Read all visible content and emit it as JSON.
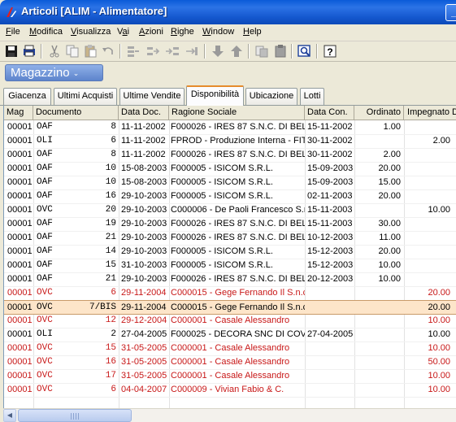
{
  "window": {
    "title": "Articoli [ALIM - Alimentatore]",
    "minimize_label": "_"
  },
  "menu": [
    {
      "label": "File",
      "key": "F"
    },
    {
      "label": "Modifica",
      "key": "M"
    },
    {
      "label": "Visualizza",
      "key": "V"
    },
    {
      "label": "Vai",
      "key": "a"
    },
    {
      "label": "Azioni",
      "key": "A"
    },
    {
      "label": "Righe",
      "key": "R"
    },
    {
      "label": "Window",
      "key": "W"
    },
    {
      "label": "Help",
      "key": "H"
    }
  ],
  "toolbar": {
    "icons": [
      "save-icon",
      "print-preview-icon",
      "cut-icon",
      "copy-icon",
      "paste-icon",
      "undo-icon",
      "insert-row-icon",
      "move-row-right-icon",
      "move-row-in-icon",
      "move-row-end-icon",
      "arrow-down-icon",
      "arrow-up-icon",
      "copy-record-icon",
      "paste-record-icon",
      "preview-icon",
      "help-icon"
    ]
  },
  "panel": {
    "title": "Magazzino",
    "arrow": "⌄"
  },
  "tabs": [
    {
      "label": "Giacenza"
    },
    {
      "label": "Ultimi Acquisti"
    },
    {
      "label": "Ultime Vendite"
    },
    {
      "label": "Disponibilità",
      "active": true
    },
    {
      "label": "Ubicazione"
    },
    {
      "label": "Lotti"
    }
  ],
  "grid": {
    "columns": [
      "Mag",
      "Documento",
      "Data Doc.",
      "Ragione Sociale",
      "Data Con.",
      "Ordinato",
      "Impegnato D"
    ],
    "rows": [
      {
        "mag": "00001",
        "doc_type": "OAF",
        "doc_num": "8",
        "data_doc": "11-11-2002",
        "ragione": "F000026 - IRES 87 S.N.C. DI BELL",
        "data_con": "15-11-2002",
        "ordinato": "1.00",
        "impegnato": "",
        "style": "normal"
      },
      {
        "mag": "00001",
        "doc_type": "OLI",
        "doc_num": "6",
        "data_doc": "11-11-2002",
        "ragione": "FPROD   - Produzione Interna - FIT",
        "data_con": "30-11-2002",
        "ordinato": "",
        "impegnato": "2.00",
        "style": "normal"
      },
      {
        "mag": "00001",
        "doc_type": "OAF",
        "doc_num": "8",
        "data_doc": "11-11-2002",
        "ragione": "F000026 - IRES 87 S.N.C. DI BELL",
        "data_con": "30-11-2002",
        "ordinato": "2.00",
        "impegnato": "",
        "style": "normal"
      },
      {
        "mag": "00001",
        "doc_type": "OAF",
        "doc_num": "10",
        "data_doc": "15-08-2003",
        "ragione": "F000005 - ISICOM S.R.L.",
        "data_con": "15-09-2003",
        "ordinato": "20.00",
        "impegnato": "",
        "style": "normal"
      },
      {
        "mag": "00001",
        "doc_type": "OAF",
        "doc_num": "10",
        "data_doc": "15-08-2003",
        "ragione": "F000005 - ISICOM S.R.L.",
        "data_con": "15-09-2003",
        "ordinato": "15.00",
        "impegnato": "",
        "style": "normal"
      },
      {
        "mag": "00001",
        "doc_type": "OAF",
        "doc_num": "16",
        "data_doc": "29-10-2003",
        "ragione": "F000005 - ISICOM S.R.L.",
        "data_con": "02-11-2003",
        "ordinato": "20.00",
        "impegnato": "",
        "style": "normal"
      },
      {
        "mag": "00001",
        "doc_type": "OVC",
        "doc_num": "20",
        "data_doc": "29-10-2003",
        "ragione": "C000006 - De Paoli Francesco S.r",
        "data_con": "15-11-2003",
        "ordinato": "",
        "impegnato": "10.00",
        "style": "normal"
      },
      {
        "mag": "00001",
        "doc_type": "OAF",
        "doc_num": "19",
        "data_doc": "29-10-2003",
        "ragione": "F000026 - IRES 87 S.N.C. DI BELL",
        "data_con": "15-11-2003",
        "ordinato": "30.00",
        "impegnato": "",
        "style": "normal"
      },
      {
        "mag": "00001",
        "doc_type": "OAF",
        "doc_num": "21",
        "data_doc": "29-10-2003",
        "ragione": "F000026 - IRES 87 S.N.C. DI BELL",
        "data_con": "10-12-2003",
        "ordinato": "11.00",
        "impegnato": "",
        "style": "normal"
      },
      {
        "mag": "00001",
        "doc_type": "OAF",
        "doc_num": "14",
        "data_doc": "29-10-2003",
        "ragione": "F000005 - ISICOM S.R.L.",
        "data_con": "15-12-2003",
        "ordinato": "20.00",
        "impegnato": "",
        "style": "normal"
      },
      {
        "mag": "00001",
        "doc_type": "OAF",
        "doc_num": "15",
        "data_doc": "31-10-2003",
        "ragione": "F000005 - ISICOM S.R.L.",
        "data_con": "15-12-2003",
        "ordinato": "10.00",
        "impegnato": "",
        "style": "normal"
      },
      {
        "mag": "00001",
        "doc_type": "OAF",
        "doc_num": "21",
        "data_doc": "29-10-2003",
        "ragione": "F000026 - IRES 87 S.N.C. DI BELL",
        "data_con": "20-12-2003",
        "ordinato": "10.00",
        "impegnato": "",
        "style": "normal"
      },
      {
        "mag": "00001",
        "doc_type": "OVC",
        "doc_num": "6",
        "data_doc": "29-11-2004",
        "ragione": "C000015 - Gege Fernando Il S.n.c",
        "data_con": "",
        "ordinato": "",
        "impegnato": "20.00",
        "style": "red"
      },
      {
        "mag": "00001",
        "doc_type": "OVC",
        "doc_num": "7/BIS",
        "data_doc": "29-11-2004",
        "ragione": "C000015 - Gege Fernando Il S.n.c",
        "data_con": "",
        "ordinato": "",
        "impegnato": "20.00",
        "style": "selected"
      },
      {
        "mag": "00001",
        "doc_type": "OVC",
        "doc_num": "12",
        "data_doc": "29-12-2004",
        "ragione": "C000001 - Casale Alessandro",
        "data_con": "",
        "ordinato": "",
        "impegnato": "10.00",
        "style": "red"
      },
      {
        "mag": "00001",
        "doc_type": "OLI",
        "doc_num": "2",
        "data_doc": "27-04-2005",
        "ragione": "F000025 - DECORA SNC DI COVIL",
        "data_con": "27-04-2005",
        "ordinato": "",
        "impegnato": "10.00",
        "style": "normal"
      },
      {
        "mag": "00001",
        "doc_type": "OVC",
        "doc_num": "15",
        "data_doc": "31-05-2005",
        "ragione": "C000001 - Casale Alessandro",
        "data_con": "",
        "ordinato": "",
        "impegnato": "10.00",
        "style": "red"
      },
      {
        "mag": "00001",
        "doc_type": "OVC",
        "doc_num": "16",
        "data_doc": "31-05-2005",
        "ragione": "C000001 - Casale Alessandro",
        "data_con": "",
        "ordinato": "",
        "impegnato": "50.00",
        "style": "red"
      },
      {
        "mag": "00001",
        "doc_type": "OVC",
        "doc_num": "17",
        "data_doc": "31-05-2005",
        "ragione": "C000001 - Casale Alessandro",
        "data_con": "",
        "ordinato": "",
        "impegnato": "10.00",
        "style": "red"
      },
      {
        "mag": "00001",
        "doc_type": "OVC",
        "doc_num": "6",
        "data_doc": "04-04-2007",
        "ragione": "C000009 - Vivian Fabio & C.",
        "data_con": "",
        "ordinato": "",
        "impegnato": "10.00",
        "style": "red"
      }
    ]
  },
  "colors": {
    "titlebar": "#0a5bd8",
    "row_red": "#c81818",
    "row_selected_bg": "#fde5c9",
    "tab_active_accent": "#e68b2c"
  }
}
